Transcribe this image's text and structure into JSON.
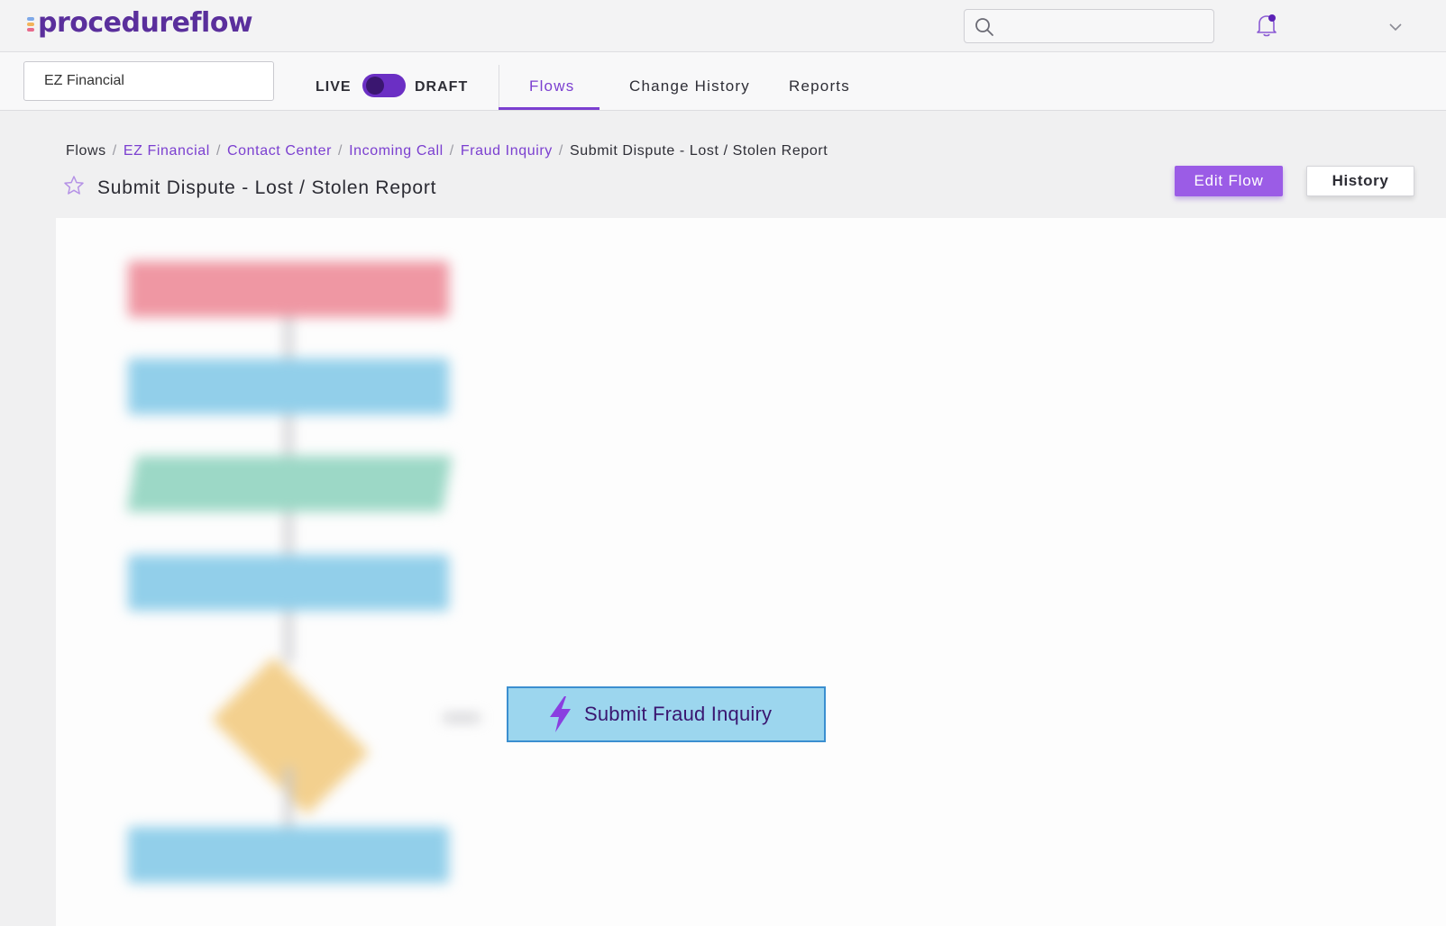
{
  "header": {
    "logo_text": "procedureflow",
    "search_placeholder": "",
    "icons": [
      "search-icon",
      "bell-icon",
      "chevron-down-icon"
    ],
    "accent_color": "#7b3fd0"
  },
  "subnav": {
    "workspace": "EZ Financial",
    "mode_live_label": "LIVE",
    "mode_draft_label": "DRAFT",
    "tabs": [
      {
        "label": "Flows",
        "active": true
      },
      {
        "label": "Change History",
        "active": false
      },
      {
        "label": "Reports",
        "active": false
      }
    ]
  },
  "breadcrumb": {
    "items": [
      "Flows",
      "EZ Financial",
      "Contact Center",
      "Incoming Call",
      "Fraud Inquiry",
      "Submit Dispute - Lost / Stolen Report"
    ],
    "separator": "/"
  },
  "page": {
    "title": "Submit Dispute - Lost / Stolen Report",
    "edit_button": "Edit Flow",
    "history_button": "History"
  },
  "flow": {
    "action_node_label": "Submit Fraud Inquiry",
    "action_icon": "lightning-bolt-icon"
  }
}
